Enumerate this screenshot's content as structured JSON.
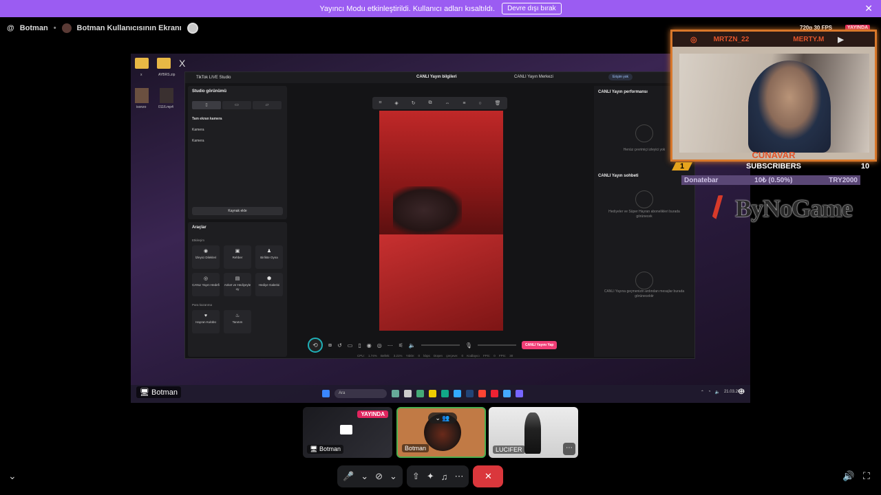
{
  "banner": {
    "text": "Yayıncı Modu etkinleştirildi. Kullanıcı adları kısaltıldı.",
    "button": "Devre dışı bırak",
    "close": "✕"
  },
  "topbar": {
    "channel": "Botman",
    "separator": "•",
    "stream_title": "Botman Kullanıcısının Ekranı"
  },
  "stream": {
    "desk_labels": [
      "x",
      "AYBRS.zip",
      "isonzo",
      "0116.mp4"
    ],
    "studio": {
      "app_title": "TikTok LIVE Studio",
      "center_title": "CANLI Yayın bilgileri",
      "right_title": "CANLI Yayın Merkezi",
      "access": "Erişim yok",
      "studio_view": "Studio görünümü",
      "fullscreen_cam": "Tam ekran kamera",
      "camera_1": "Kamera",
      "camera_2": "Kamera",
      "add_source": "Kaynak ekle",
      "tools_title": "Araçlar",
      "section_interaction": "Etkileşim",
      "section_earn": "Para kazanma",
      "tools": [
        "İzleyici Dilekleri",
        "Rehber",
        "Birlikte Oyna",
        "CANLI Yayın Hedefi",
        "Anket ve Hediyeyle oy",
        "Hediye Galerisi",
        "Hayran Kulübü",
        "Tanıtım"
      ],
      "perf_title": "CANLI Yayın performansı",
      "perf_empty": "Henüz çevrimiçi izleyici yok",
      "chat_title": "CANLI Yayın sohbeti",
      "chat_gifts": "Hediyeler ve Süper Hayran abonelikleri burada görünecek",
      "chat_msgs": "CANLI Yayına geçmenizin ardından mesajlar burada görünecektir",
      "go_live": "CANLI Yayını Yap",
      "stats": "CPU: 1.74% Bellek: 3.21% Yükle: 0 kbps Düşen çerçeve: 0 Kodlayıcı FPS: 0 FPS: 30"
    },
    "taskbar": {
      "search": "Ara",
      "date": "21.03.2026"
    },
    "label": "Botman",
    "sublabel": "Botman"
  },
  "overlay": {
    "resolution": "720p 30 FPS",
    "live_badge": "YAYINDA",
    "name_left": "MRTZN_22",
    "name_right": "MERTY.M",
    "cam_name": "CUNAVAR",
    "rank": "1",
    "subs_label": "SUBSCRIBERS",
    "subs_count": "10",
    "donate_label": "Donatebar",
    "donate_progress": "10₺ (0.50%)",
    "donate_goal": "TRY2000",
    "brand": "ByNoGame"
  },
  "participants": [
    {
      "label": "Botman",
      "live": "YAYINDA"
    },
    {
      "label": "Botman",
      "chevron": "⌄"
    },
    {
      "label": "LUCIFER",
      "more": "⋯"
    }
  ],
  "controls": {
    "mic": "🎤",
    "cam_off": "⊘",
    "share": "⇧",
    "activities": "✦",
    "soundboard": "♫",
    "more": "⋯",
    "hangup": "✕"
  },
  "colors": {
    "banner": "#9b5cf2",
    "live": "#e0245e",
    "hangup": "#da373c",
    "speaking": "#4caf50",
    "overlay_accent": "#d8772a"
  }
}
